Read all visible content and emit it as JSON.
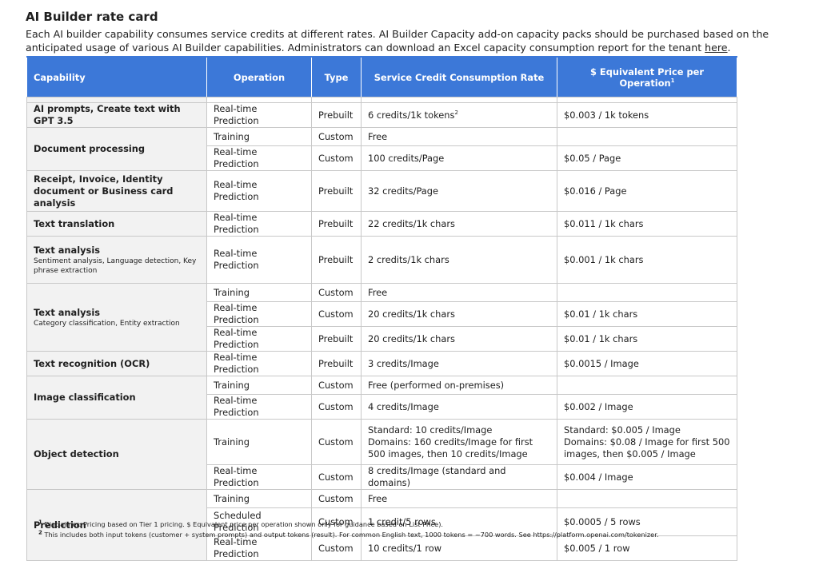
{
  "heading": "AI Builder rate card",
  "intro": {
    "text": "Each AI builder capability consumes service credits at different rates. AI Builder Capacity add-on capacity packs should be purchased based on the anticipated usage of various AI Builder capabilities. Administrators can download an Excel capacity consumption report for the tenant ",
    "link": "here",
    "end": "."
  },
  "table": {
    "headers": {
      "capability": "Capability",
      "operation": "Operation",
      "type": "Type",
      "rate": "Service Credit Consumption Rate",
      "price": "$ Equivalent Price per Operation",
      "price_sup": "1"
    },
    "rows": {
      "r1": {
        "cap": "AI prompts, Create text with GPT 3.5",
        "op": "Real-time Prediction",
        "type": "Prebuilt",
        "rate": "6 credits/1k tokens",
        "rate_sup": "2",
        "price": "$0.003 / 1k tokens"
      },
      "r2": {
        "cap": "Document processing",
        "op": "Training",
        "type": "Custom",
        "rate": "Free",
        "price": ""
      },
      "r3": {
        "op": "Real-time Prediction",
        "type": "Custom",
        "rate": "100 credits/Page",
        "price": "$0.05 / Page"
      },
      "r4": {
        "cap": "Receipt, Invoice, Identity document or Business card analysis",
        "op": "Real-time Prediction",
        "type": "Prebuilt",
        "rate": "32 credits/Page",
        "price": "$0.016 / Page"
      },
      "r5": {
        "cap": "Text translation",
        "op": "Real-time Prediction",
        "type": "Prebuilt",
        "rate": "22 credits/1k chars",
        "price": "$0.011 / 1k chars"
      },
      "r6": {
        "cap": "Text analysis",
        "sub": "Sentiment analysis, Language detection, Key phrase extraction",
        "op": "Real-time Prediction",
        "type": "Prebuilt",
        "rate": "2 credits/1k chars",
        "price": "$0.001 / 1k chars"
      },
      "r7": {
        "cap": "Text analysis",
        "sub": "Category classification, Entity extraction",
        "op": "Training",
        "type": "Custom",
        "rate": "Free",
        "price": ""
      },
      "r8": {
        "op": "Real-time Prediction",
        "type": "Custom",
        "rate": "20 credits/1k chars",
        "price": "$0.01 / 1k chars"
      },
      "r9": {
        "op": "Real-time Prediction",
        "type": "Prebuilt",
        "rate": "20 credits/1k chars",
        "price": "$0.01 / 1k chars"
      },
      "r10": {
        "cap": "Text recognition (OCR)",
        "op": "Real-time Prediction",
        "type": "Prebuilt",
        "rate": "3 credits/Image",
        "price": "$0.0015 / Image"
      },
      "r11": {
        "cap": "Image classification",
        "op": "Training",
        "type": "Custom",
        "rate": "Free (performed on-premises)",
        "price": ""
      },
      "r12": {
        "op": "Real-time Prediction",
        "type": "Custom",
        "rate": "4 credits/Image",
        "price": "$0.002 / Image"
      },
      "r13": {
        "cap": "Object detection",
        "op": "Training",
        "type": "Custom",
        "rate_l1": "Standard: 10 credits/Image",
        "rate_l2": "Domains: 160 credits/Image for first 500 images, then 10 credits/Image",
        "price_l1": "Standard: $0.005 / Image",
        "price_l2": "Domains: $0.08 / Image for first 500 images, then $0.005 / Image"
      },
      "r14": {
        "op": "Real-time Prediction",
        "type": "Custom",
        "rate": "8 credits/Image (standard and domains)",
        "price": "$0.004 / Image"
      },
      "r15": {
        "cap": "Prediction",
        "op": "Training",
        "type": "Custom",
        "rate": "Free",
        "price": ""
      },
      "r16": {
        "op": "Scheduled Prediction",
        "type": "Custom",
        "rate": "1 credit/5 rows",
        "price": "$0.0005 / 5 rows"
      },
      "r17": {
        "op": "Real-time Prediction",
        "type": "Custom",
        "rate": "10 credits/1 row",
        "price": "$0.005 / 1 row"
      }
    }
  },
  "notes": {
    "n1_mark": "1",
    "n1": "Disclaimer: Pricing based on Tier 1 pricing. $ Equivalent price per operation shown only for guidance based on List Price).",
    "n2_mark": "2",
    "n2": "This includes both input tokens (customer + system prompts) and output tokens (result). For common English text, 1000 tokens = ~700 words. See https://platform.openai.com/tokenizer."
  },
  "colors": {
    "header_bg": "#3c78d8",
    "capability_bg": "#f2f2f2",
    "grid": "#c8c8c8"
  }
}
